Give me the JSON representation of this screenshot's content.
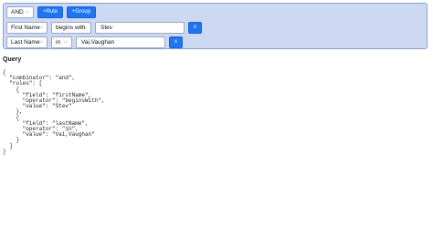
{
  "builder": {
    "combinator": "AND",
    "add_rule_label": "+Rule",
    "add_group_label": "+Group",
    "remove_label": "x",
    "rules": [
      {
        "field": "First Name",
        "operator": "begins with",
        "value": "Stev"
      },
      {
        "field": "Last Name",
        "operator": "in",
        "value": "Vai,Vaughan"
      }
    ]
  },
  "query": {
    "heading": "Query",
    "json_text": "{\n  \"combinator\": \"and\",\n  \"rules\": [\n    {\n      \"field\": \"firstName\",\n      \"operator\": \"beginsWith\",\n      \"value\": \"Stev\"\n    },\n    {\n      \"field\": \"lastName\",\n      \"operator\": \"in\",\n      \"value\": \"Vai,Vaughan\"\n    }\n  ]\n}"
  },
  "icons": {
    "dropdown": "chevron-down-icon"
  },
  "colors": {
    "panel_bg": "#cdd9f2",
    "panel_border": "#8aa3cf",
    "button_primary": "#1f75f2"
  }
}
